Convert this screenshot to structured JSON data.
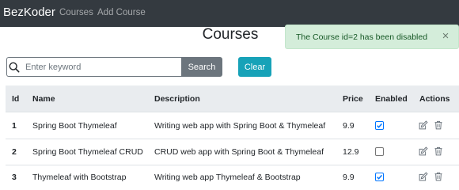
{
  "navbar": {
    "brand": "BezKoder",
    "links": [
      "Courses",
      "Add Course"
    ]
  },
  "page_title": "Courses",
  "alert": {
    "message": "The Course id=2 has been disabled",
    "close": "×"
  },
  "search": {
    "placeholder": "Enter keyword",
    "value": "",
    "button_label": "Search",
    "clear_label": "Clear"
  },
  "table": {
    "columns": [
      "Id",
      "Name",
      "Description",
      "Price",
      "Enabled",
      "Actions"
    ],
    "rows": [
      {
        "id": "1",
        "name": "Spring Boot Thymeleaf",
        "description": "Writing web app with Spring Boot & Thymeleaf",
        "price": "9.9",
        "enabled": true
      },
      {
        "id": "2",
        "name": "Spring Boot Thymeleaf CRUD",
        "description": "CRUD web app with Spring Boot & Thymeleaf",
        "price": "12.9",
        "enabled": false
      },
      {
        "id": "3",
        "name": "Thymeleaf with Bootstrap",
        "description": "Writing web app Thymeleaf & Bootstrap",
        "price": "9.9",
        "enabled": true
      }
    ]
  },
  "colors": {
    "navbar": "#343a40",
    "alert_bg": "#d4edda",
    "alert_text": "#155724",
    "search_button": "#6c757d",
    "clear_button": "#17a2b8",
    "checkbox_checked": "#0075ff"
  },
  "icons": {
    "search": "search-icon",
    "edit": "edit-icon",
    "delete": "trash-icon"
  }
}
